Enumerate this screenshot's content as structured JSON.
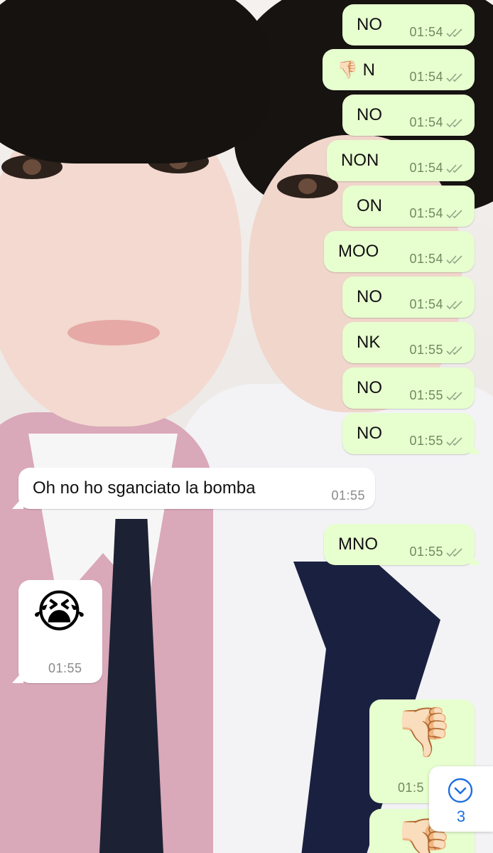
{
  "messages": [
    {
      "dir": "out",
      "text": "NO",
      "time": "01:54",
      "status": "double-check-icon"
    },
    {
      "dir": "out",
      "emoji": "👎🏻",
      "text": "N",
      "time": "01:54",
      "status": "double-check-icon"
    },
    {
      "dir": "out",
      "text": "NO",
      "time": "01:54",
      "status": "double-check-icon"
    },
    {
      "dir": "out",
      "text": "NON",
      "time": "01:54",
      "status": "double-check-icon"
    },
    {
      "dir": "out",
      "text": "ON",
      "time": "01:54",
      "status": "double-check-icon"
    },
    {
      "dir": "out",
      "text": "MOO",
      "time": "01:54",
      "status": "double-check-icon"
    },
    {
      "dir": "out",
      "text": "NO",
      "time": "01:54",
      "status": "double-check-icon"
    },
    {
      "dir": "out",
      "text": "NK",
      "time": "01:55",
      "status": "double-check-icon"
    },
    {
      "dir": "out",
      "text": "NO",
      "time": "01:55",
      "status": "double-check-icon"
    },
    {
      "dir": "out",
      "text": "NO",
      "time": "01:55",
      "status": "double-check-icon"
    },
    {
      "dir": "in",
      "text": "Oh no ho sganciato la bomba",
      "time": "01:55"
    },
    {
      "dir": "out",
      "text": "MNO",
      "time": "01:55",
      "status": "double-check-icon"
    },
    {
      "dir": "in",
      "emoji": "😭",
      "time": "01:55"
    },
    {
      "dir": "out",
      "emoji": "👎🏻",
      "time": "01:5"
    },
    {
      "dir": "out",
      "emoji": "👎🏻"
    }
  ],
  "scroll_button": {
    "icon": "chevron-down-icon",
    "unread_count": "3"
  },
  "colors": {
    "outgoing_bubble": "#e7fecf",
    "incoming_bubble": "#ffffff",
    "accent": "#1f6fe0"
  }
}
